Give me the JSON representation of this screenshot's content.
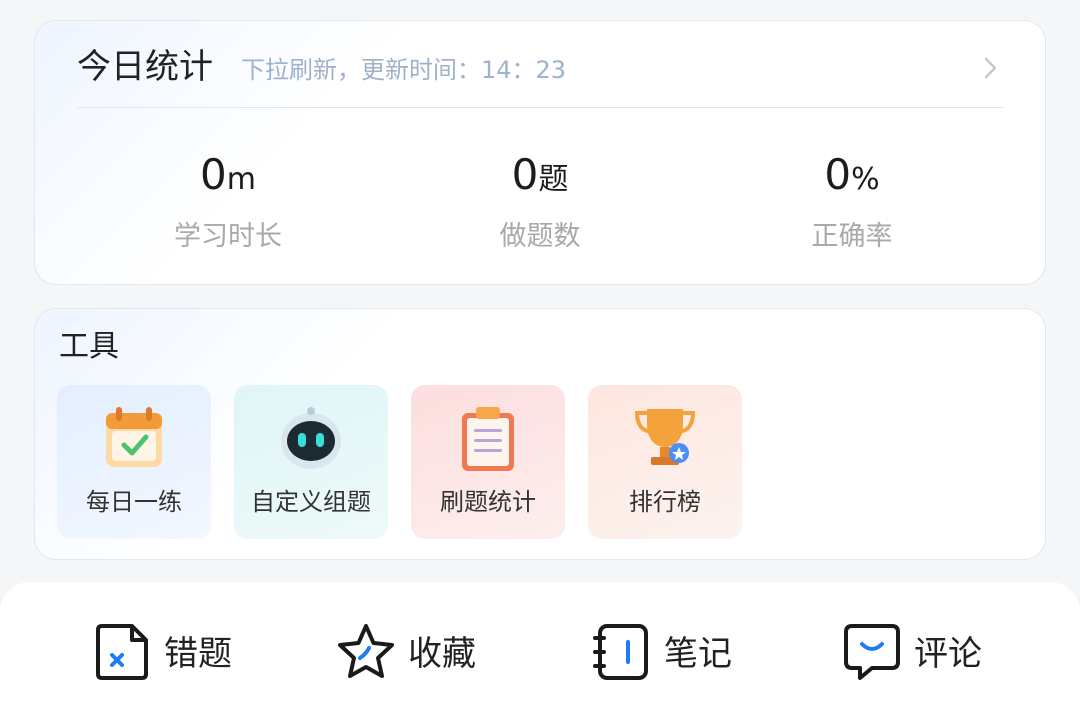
{
  "stats": {
    "title": "今日统计",
    "subtitle": "下拉刷新，更新时间：14：23",
    "metrics": [
      {
        "value": "0",
        "unit": "m",
        "label": "学习时长"
      },
      {
        "value": "0",
        "unit": "题",
        "label": "做题数"
      },
      {
        "value": "0",
        "unit": "%",
        "label": "正确率"
      }
    ]
  },
  "tools": {
    "title": "工具",
    "items": [
      {
        "label": "每日一练",
        "icon": "calendar-check-icon",
        "bg": "#e9f2ff"
      },
      {
        "label": "自定义组题",
        "icon": "robot-icon",
        "bg": "#e6f7f9"
      },
      {
        "label": "刷题统计",
        "icon": "clipboard-icon",
        "bg": "#fde9e8"
      },
      {
        "label": "排行榜",
        "icon": "trophy-icon",
        "bg": "#fdf0ec"
      }
    ]
  },
  "bottom_bar": {
    "items": [
      {
        "label": "错题",
        "icon": "wrong-question-icon"
      },
      {
        "label": "收藏",
        "icon": "star-icon"
      },
      {
        "label": "笔记",
        "icon": "notebook-icon"
      },
      {
        "label": "评论",
        "icon": "comment-icon"
      }
    ]
  },
  "colors": {
    "accent_blue": "#1f7cf6",
    "subtitle": "#9fb2cc",
    "label_gray": "#a9a9a9"
  }
}
